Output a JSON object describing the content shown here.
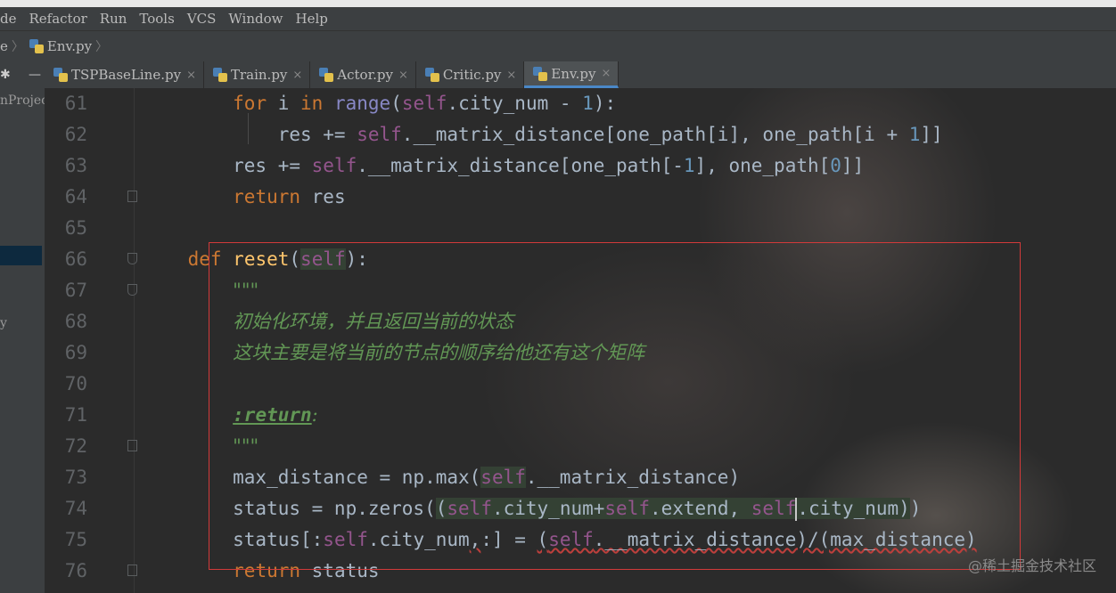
{
  "menubar": {
    "items": [
      "de",
      "Refactor",
      "Run",
      "Tools",
      "VCS",
      "Window",
      "Help"
    ]
  },
  "navbar": {
    "crumb_prev": "e",
    "file": "Env.py"
  },
  "tabs": [
    {
      "label": "TSPBaseLine.py",
      "close": "×"
    },
    {
      "label": "Train.py",
      "close": "×"
    },
    {
      "label": "Actor.py",
      "close": "×"
    },
    {
      "label": "Critic.py",
      "close": "×"
    },
    {
      "label": "Env.py",
      "close": "×"
    }
  ],
  "tool_stub": {
    "icon": "✱",
    "minimize": "—"
  },
  "left_panel": {
    "project_text": "nProject",
    "y_text": "y"
  },
  "editor": {
    "lines": [
      {
        "n": "61"
      },
      {
        "n": "62"
      },
      {
        "n": "63"
      },
      {
        "n": "64"
      },
      {
        "n": "65"
      },
      {
        "n": "66"
      },
      {
        "n": "67"
      },
      {
        "n": "68"
      },
      {
        "n": "69"
      },
      {
        "n": "70"
      },
      {
        "n": "71"
      },
      {
        "n": "72"
      },
      {
        "n": "73"
      },
      {
        "n": "74"
      },
      {
        "n": "75"
      },
      {
        "n": "76"
      }
    ],
    "docstring_line1": "初始化环境，并且返回当前的状态",
    "docstring_line2": "这块主要是将当前的节点的顺序给他还有这个矩阵"
  },
  "watermark": "@稀土掘金技术社区",
  "colors": {
    "keyword": "#cc7832",
    "self": "#94558d",
    "builtin": "#8888c6",
    "number": "#6897bb",
    "docstring": "#629755",
    "selection_box": "#d23a3a",
    "active_tab_underline": "#4a88c7"
  }
}
